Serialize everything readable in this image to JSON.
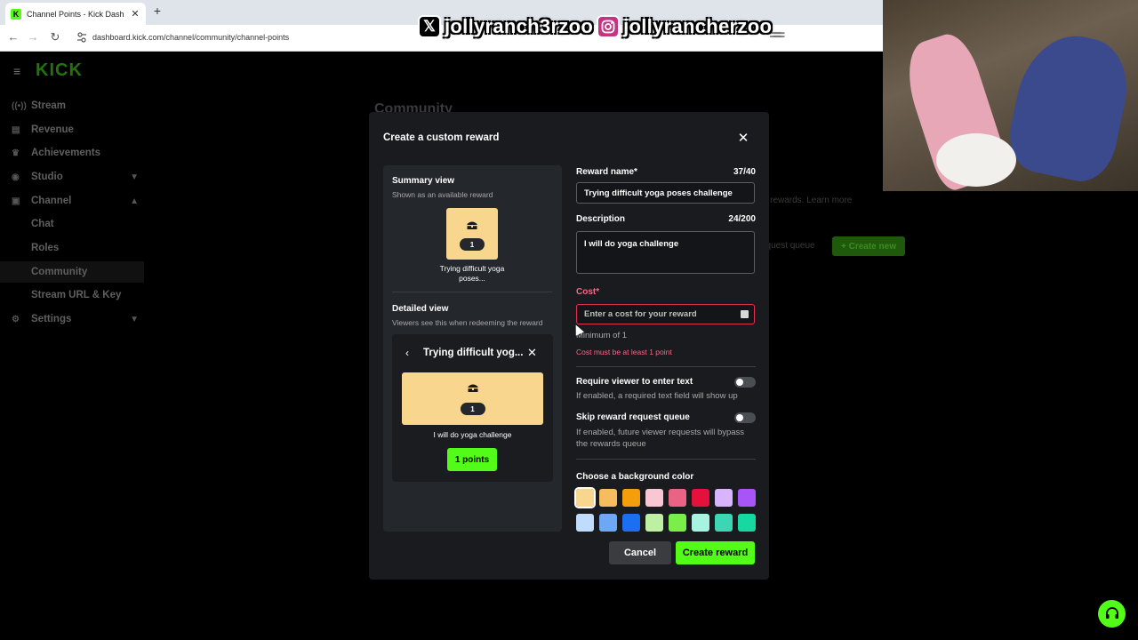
{
  "browser": {
    "tab_title": "Channel Points - Kick Dashboard",
    "tab_favicon": "K",
    "new_tab": "+",
    "tab_close": "✕",
    "url": "dashboard.kick.com/channel/community/channel-points"
  },
  "overlay": {
    "x_handle": "jollyranch3rzoo",
    "ig_handle": "jollyrancherzoo_"
  },
  "sidebar": {
    "logo": "KICK",
    "items": [
      {
        "label": "Stream",
        "icon": "stream-icon"
      },
      {
        "label": "Revenue",
        "icon": "revenue-icon"
      },
      {
        "label": "Achievements",
        "icon": "trophy-icon"
      },
      {
        "label": "Studio",
        "icon": "studio-icon"
      },
      {
        "label": "Channel",
        "icon": "channel-icon"
      },
      {
        "label": "Chat"
      },
      {
        "label": "Roles"
      },
      {
        "label": "Community"
      },
      {
        "label": "Stream URL & Key"
      },
      {
        "label": "Settings",
        "icon": "gear-icon"
      }
    ]
  },
  "background": {
    "page_title": "Community",
    "learn_more": "r rewards. Learn more",
    "request_queue": "equest queue",
    "create_new": "+ Create new"
  },
  "modal": {
    "title": "Create a custom reward",
    "summary_heading": "Summary view",
    "summary_sub": "Shown as an available reward",
    "summary_cost": "1",
    "summary_label": "Trying difficult yoga poses...",
    "detailed_heading": "Detailed view",
    "detailed_sub": "Viewers see this when redeeming the reward",
    "detail_title": "Trying difficult yog...",
    "detail_cost": "1",
    "detail_description": "I will do yoga challenge",
    "detail_button": "1 points",
    "form": {
      "reward_name_label": "Reward name*",
      "reward_name_count": "37/40",
      "reward_name_value": "Trying difficult yoga poses challenge",
      "description_label": "Description",
      "description_count": "24/200",
      "description_value": "I will do yoga challenge",
      "cost_label": "Cost*",
      "cost_placeholder": "Enter a cost for your reward",
      "cost_hint": "Minimum of 1",
      "cost_error": "Cost must be at least 1 point",
      "require_text_label": "Require viewer to enter text",
      "require_text_desc": "If enabled, a required text field will show up",
      "skip_queue_label": "Skip reward request queue",
      "skip_queue_desc": "If enabled, future viewer requests will bypass the rewards queue",
      "bg_color_label": "Choose a background color"
    },
    "colors": [
      "#f9d68d",
      "#f6bd60",
      "#f59e0b",
      "#f9c7d3",
      "#e96384",
      "#e3113b",
      "#d8b4fe",
      "#a855f7",
      "#bfdbfe",
      "#6ea8f5",
      "#1d6ff2",
      "#bef0a3",
      "#7aef4a",
      "#a8f2e1",
      "#3cd6b4",
      "#16d8a0"
    ],
    "selected_color": "#f9d68d",
    "cancel": "Cancel",
    "create": "Create reward"
  }
}
